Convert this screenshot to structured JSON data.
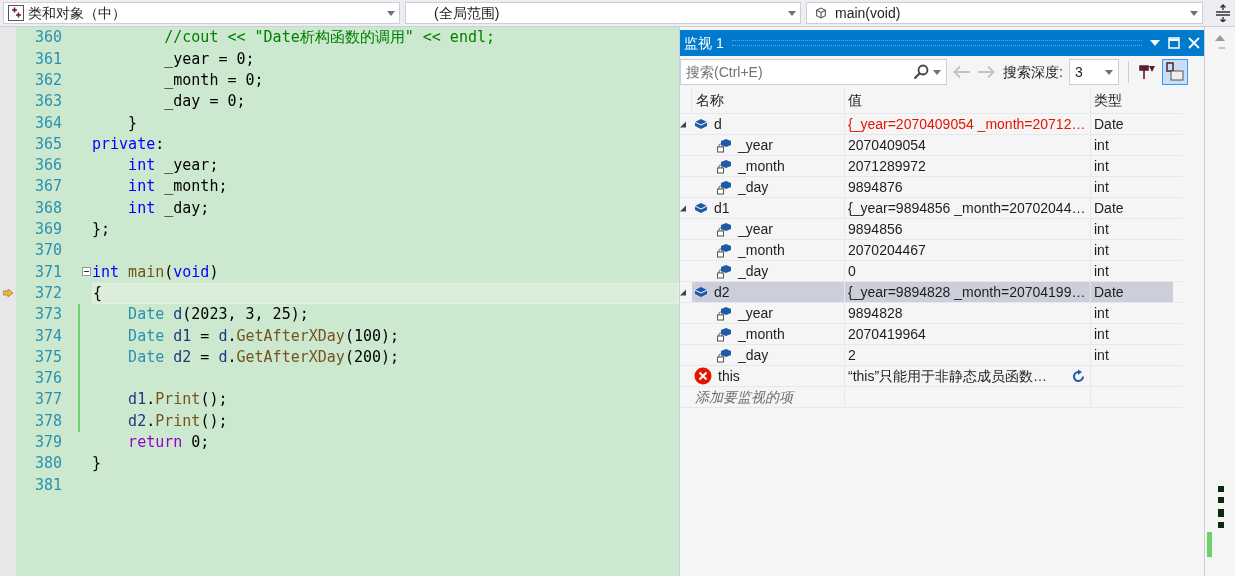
{
  "toolbar": {
    "class_dropdown": "类和对象（中）",
    "scope_dropdown": "(全局范围)",
    "function_dropdown": "main(void)"
  },
  "editor": {
    "lines": [
      {
        "number": "360",
        "changed": false,
        "current": false,
        "fold": false,
        "tokens": [
          {
            "kind": "comment",
            "text": "        //cout << \"Date析构函数的调用\" << endl;"
          }
        ]
      },
      {
        "number": "361",
        "changed": false,
        "current": false,
        "fold": false,
        "tokens": [
          {
            "kind": "plain",
            "text": "        _year = 0;"
          }
        ]
      },
      {
        "number": "362",
        "changed": false,
        "current": false,
        "fold": false,
        "tokens": [
          {
            "kind": "plain",
            "text": "        _month = 0;"
          }
        ]
      },
      {
        "number": "363",
        "changed": false,
        "current": false,
        "fold": false,
        "tokens": [
          {
            "kind": "plain",
            "text": "        _day = 0;"
          }
        ]
      },
      {
        "number": "364",
        "changed": false,
        "current": false,
        "fold": false,
        "tokens": [
          {
            "kind": "plain",
            "text": "    }"
          }
        ]
      },
      {
        "number": "365",
        "changed": false,
        "current": false,
        "fold": false,
        "tokens": [
          {
            "kind": "keyword",
            "text": "private"
          },
          {
            "kind": "plain",
            "text": ":"
          }
        ]
      },
      {
        "number": "366",
        "changed": false,
        "current": false,
        "fold": false,
        "tokens": [
          {
            "kind": "keyword",
            "text": "    int"
          },
          {
            "kind": "plain",
            "text": " _year;"
          }
        ]
      },
      {
        "number": "367",
        "changed": false,
        "current": false,
        "fold": false,
        "tokens": [
          {
            "kind": "keyword",
            "text": "    int"
          },
          {
            "kind": "plain",
            "text": " _month;"
          }
        ]
      },
      {
        "number": "368",
        "changed": false,
        "current": false,
        "fold": false,
        "tokens": [
          {
            "kind": "keyword",
            "text": "    int"
          },
          {
            "kind": "plain",
            "text": " _day;"
          }
        ]
      },
      {
        "number": "369",
        "changed": false,
        "current": false,
        "fold": false,
        "tokens": [
          {
            "kind": "plain",
            "text": "};"
          }
        ]
      },
      {
        "number": "370",
        "changed": false,
        "current": false,
        "fold": false
      },
      {
        "number": "371",
        "changed": false,
        "current": false,
        "fold": true,
        "tokens": [
          {
            "kind": "keyword",
            "text": "int"
          },
          {
            "kind": "function",
            "text": " main"
          },
          {
            "kind": "plain",
            "text": "("
          },
          {
            "kind": "keyword",
            "text": "void"
          },
          {
            "kind": "plain",
            "text": ")"
          }
        ]
      },
      {
        "number": "372",
        "changed": false,
        "current": true,
        "fold": false,
        "tokens": [
          {
            "kind": "plain",
            "text": "{"
          }
        ]
      },
      {
        "number": "373",
        "changed": true,
        "current": false,
        "fold": false,
        "tokens": [
          {
            "kind": "type",
            "text": "    Date"
          },
          {
            "kind": "variable",
            "text": " d"
          },
          {
            "kind": "plain",
            "text": "(2023, 3, 25);"
          }
        ]
      },
      {
        "number": "374",
        "changed": true,
        "current": false,
        "fold": false,
        "tokens": [
          {
            "kind": "type",
            "text": "    Date"
          },
          {
            "kind": "variable",
            "text": " d1"
          },
          {
            "kind": "plain",
            "text": " = "
          },
          {
            "kind": "variable",
            "text": "d"
          },
          {
            "kind": "plain",
            "text": "."
          },
          {
            "kind": "function",
            "text": "GetAfterXDay"
          },
          {
            "kind": "plain",
            "text": "(100);"
          }
        ]
      },
      {
        "number": "375",
        "changed": true,
        "current": false,
        "fold": false,
        "tokens": [
          {
            "kind": "type",
            "text": "    Date"
          },
          {
            "kind": "variable",
            "text": " d2"
          },
          {
            "kind": "plain",
            "text": " = "
          },
          {
            "kind": "variable",
            "text": "d"
          },
          {
            "kind": "plain",
            "text": "."
          },
          {
            "kind": "function",
            "text": "GetAfterXDay"
          },
          {
            "kind": "plain",
            "text": "(200);"
          }
        ]
      },
      {
        "number": "376",
        "changed": true,
        "current": false,
        "fold": false
      },
      {
        "number": "377",
        "changed": true,
        "current": false,
        "fold": false,
        "tokens": [
          {
            "kind": "variable",
            "text": "    d1"
          },
          {
            "kind": "plain",
            "text": "."
          },
          {
            "kind": "function",
            "text": "Print"
          },
          {
            "kind": "plain",
            "text": "();"
          }
        ]
      },
      {
        "number": "378",
        "changed": true,
        "current": false,
        "fold": false,
        "tokens": [
          {
            "kind": "variable",
            "text": "    d2"
          },
          {
            "kind": "plain",
            "text": "."
          },
          {
            "kind": "function",
            "text": "Print"
          },
          {
            "kind": "plain",
            "text": "();"
          }
        ]
      },
      {
        "number": "379",
        "changed": false,
        "current": false,
        "fold": false,
        "tokens": [
          {
            "kind": "control",
            "text": "    return"
          },
          {
            "kind": "plain",
            "text": " 0;"
          }
        ]
      },
      {
        "number": "380",
        "changed": false,
        "current": false,
        "fold": false,
        "tokens": [
          {
            "kind": "plain",
            "text": "}"
          }
        ]
      },
      {
        "number": "381",
        "changed": false,
        "current": false,
        "fold": false
      }
    ]
  },
  "watch": {
    "title": "监视 1",
    "search": {
      "placeholder": "搜索(Ctrl+E)"
    },
    "depth_label": "搜索深度:",
    "depth": "3",
    "columns": [
      "名称",
      "值",
      "类型"
    ],
    "items": [
      {
        "kind": "object",
        "name": "d",
        "value": "{_year=2070409054 _month=20712…",
        "type": "Date",
        "expanded": true,
        "changed": true,
        "selected": false,
        "children": [
          {
            "kind": "member",
            "name": "_year",
            "value": "2070409054",
            "type": "int",
            "changed": false,
            "selected": false
          },
          {
            "kind": "member",
            "name": "_month",
            "value": "2071289972",
            "type": "int",
            "changed": false,
            "selected": false
          },
          {
            "kind": "member",
            "name": "_day",
            "value": "9894876",
            "type": "int",
            "changed": false,
            "selected": false
          }
        ]
      },
      {
        "kind": "object",
        "name": "d1",
        "value": "{_year=9894856 _month=20702044…",
        "type": "Date",
        "expanded": true,
        "changed": false,
        "selected": false,
        "children": [
          {
            "kind": "member",
            "name": "_year",
            "value": "9894856",
            "type": "int",
            "changed": false,
            "selected": false
          },
          {
            "kind": "member",
            "name": "_month",
            "value": "2070204467",
            "type": "int",
            "changed": false,
            "selected": false
          },
          {
            "kind": "member",
            "name": "_day",
            "value": "0",
            "type": "int",
            "changed": false,
            "selected": false
          }
        ]
      },
      {
        "kind": "object",
        "name": "d2",
        "value": "{_year=9894828 _month=20704199…",
        "type": "Date",
        "expanded": true,
        "changed": false,
        "selected": true,
        "children": [
          {
            "kind": "member",
            "name": "_year",
            "value": "9894828",
            "type": "int",
            "changed": false,
            "selected": false
          },
          {
            "kind": "member",
            "name": "_month",
            "value": "2070419964",
            "type": "int",
            "changed": false,
            "selected": false
          },
          {
            "kind": "member",
            "name": "_day",
            "value": "2",
            "type": "int",
            "changed": false,
            "selected": false
          }
        ]
      },
      {
        "kind": "error",
        "name": "this",
        "value": "“this”只能用于非静态成员函数…",
        "changed": false,
        "selected": false
      }
    ],
    "add_placeholder": "添加要监视的项"
  }
}
